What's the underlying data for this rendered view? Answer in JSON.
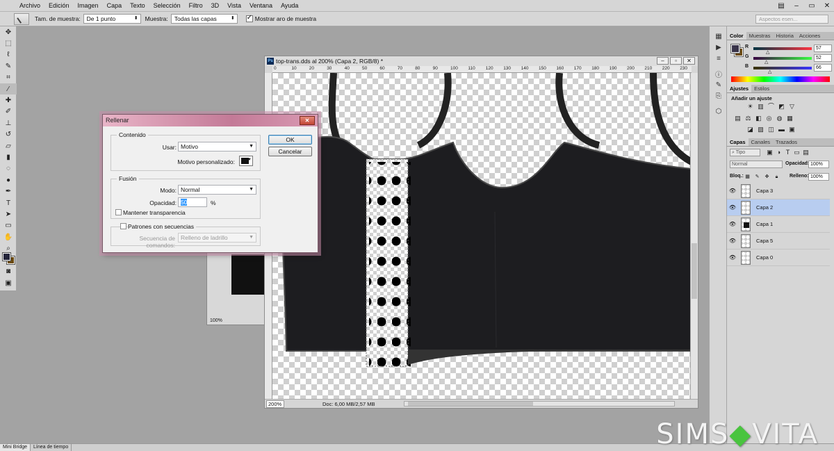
{
  "menubar": {
    "items": [
      "Archivo",
      "Edición",
      "Imagen",
      "Capa",
      "Texto",
      "Selección",
      "Filtro",
      "3D",
      "Vista",
      "Ventana",
      "Ayuda"
    ]
  },
  "options": {
    "sample_size_label": "Tam. de muestra:",
    "sample_size_value": "De 1 punto",
    "sample_label": "Muestra:",
    "sample_value": "Todas las capas",
    "show_ring_label": "Mostrar aro de muestra",
    "search_placeholder": "Aspectos esen..."
  },
  "document": {
    "title": "top-trans.dds al 200% (Capa 2, RGB/8) *",
    "zoom": "200%",
    "doc_info": "Doc: 6,00 MB/2,57 MB",
    "ruler_ticks": [
      "0",
      "10",
      "20",
      "30",
      "40",
      "50",
      "60",
      "70",
      "80",
      "90",
      "100",
      "110",
      "120",
      "130",
      "140",
      "150",
      "160",
      "170",
      "180",
      "190",
      "200",
      "210",
      "220",
      "230",
      "240",
      "250",
      "260",
      "270",
      "280",
      "290",
      "300"
    ]
  },
  "bg_document": {
    "zoom": "100%"
  },
  "dialog": {
    "title": "Rellenar",
    "content_group": "Contenido",
    "use_label": "Usar:",
    "use_value": "Motivo",
    "custom_pattern_label": "Motivo personalizado:",
    "blend_group": "Fusión",
    "mode_label": "Modo:",
    "mode_value": "Normal",
    "opacity_label": "Opacidad:",
    "opacity_value": "50",
    "percent": "%",
    "preserve_label": "Mantener transparencia",
    "scripted_label": "Patrones con secuencias",
    "script_label": "Secuencia de comandos:",
    "script_value": "Relleno de ladrillo",
    "ok": "OK",
    "cancel": "Cancelar"
  },
  "color_panel": {
    "tabs": [
      "Color",
      "Muestras",
      "Historia",
      "Acciones"
    ],
    "r_label": "R",
    "r_value": "57",
    "g_label": "G",
    "g_value": "52",
    "b_label": "B",
    "b_value": "66",
    "fg_color": "#39344a"
  },
  "adjust_panel": {
    "tabs": [
      "Ajustes",
      "Estilos"
    ],
    "heading": "Añadir un ajuste"
  },
  "layers_panel": {
    "tabs": [
      "Capas",
      "Canales",
      "Trazados"
    ],
    "filter_value": "Tipo",
    "blend_value": "Normal",
    "opacity_label": "Opacidad:",
    "opacity_value": "100%",
    "lock_label": "Bloq.:",
    "fill_label": "Relleno:",
    "fill_value": "100%",
    "layers": [
      {
        "name": "Capa 3",
        "selected": false
      },
      {
        "name": "Capa 2",
        "selected": true
      },
      {
        "name": "Capa 1",
        "selected": false
      },
      {
        "name": "Capa 5",
        "selected": false
      },
      {
        "name": "Capa 0",
        "selected": false
      }
    ]
  },
  "bottombar": {
    "tabs": [
      "Mini Bridge",
      "Línea de tiempo"
    ]
  },
  "watermark": {
    "left": "SIMS",
    "right": "VITA"
  }
}
